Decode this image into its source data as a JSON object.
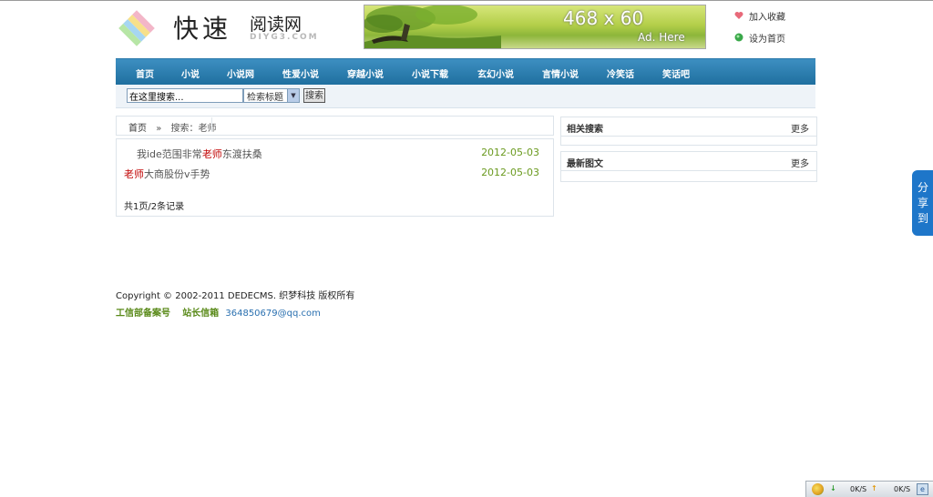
{
  "logo": {
    "title": "快速",
    "subtitle": "阅读网",
    "domain_text": "DIYG3.COM"
  },
  "banner": {
    "size_text": "468 x 60",
    "ad_text": "Ad. Here"
  },
  "top_links": [
    {
      "label": "加入收藏",
      "icon": "heart-icon"
    },
    {
      "label": "设为首页",
      "icon": "green-dot-icon"
    }
  ],
  "nav": {
    "items": [
      "首页",
      "小说",
      "小说网",
      "性爱小说",
      "穿越小说",
      "小说下载",
      "玄幻小说",
      "言情小说",
      "冷笑话",
      "笑话吧"
    ]
  },
  "search": {
    "input_value": "在这里搜索...",
    "select_value": "检索标题",
    "button_label": "搜索"
  },
  "breadcrumb": {
    "home": "首页",
    "separator": "»",
    "current": "搜索：老师"
  },
  "results": {
    "items": [
      {
        "pre": "我ide范围非常",
        "hl": "老师",
        "post": "东渡扶桑",
        "date": "2012-05-03"
      },
      {
        "pre": "",
        "hl": "老师",
        "post": "大商股份v手势",
        "date": "2012-05-03"
      }
    ],
    "count_text": "共1页/2条记录"
  },
  "sidebar": {
    "boxes": [
      {
        "title": "相关搜索",
        "more": "更多"
      },
      {
        "title": "最新图文",
        "more": "更多"
      }
    ]
  },
  "footer": {
    "copyright": "Copyright © 2002-2011 DEDECMS. 织梦科技 版权所有",
    "icp_label": "工信部备案号",
    "email_label": "站长信箱",
    "email": "364850679@qq.com"
  },
  "share_tab": {
    "label": "分享到"
  },
  "tray": {
    "download_speed": "0K/S",
    "upload_speed": "0K/S"
  },
  "colors": {
    "nav_bg": "#1f6f9f",
    "highlight": "#c00000",
    "date": "#6a9a1f",
    "share_tab": "#1e76c9"
  }
}
